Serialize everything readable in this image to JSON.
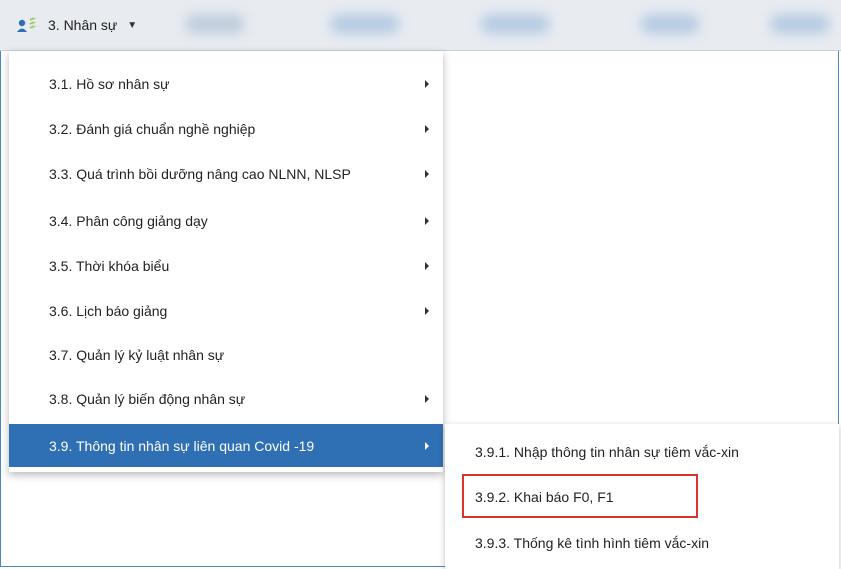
{
  "menubar": {
    "active_menu_label": "3. Nhân sự",
    "icon": "people-icon",
    "caret_icon": "caret-down-icon"
  },
  "dropdown": {
    "items": [
      {
        "label": "3.1. Hồ sơ nhân sự",
        "has_submenu": true
      },
      {
        "label": "3.2. Đánh giá chuẩn nghề nghiệp",
        "has_submenu": true
      },
      {
        "label": "3.3. Quá trình bồi dưỡng nâng cao NLNN, NLSP",
        "has_submenu": true
      },
      {
        "label": "3.4. Phân công giảng dạy",
        "has_submenu": true
      },
      {
        "label": "3.5. Thời khóa biểu",
        "has_submenu": true
      },
      {
        "label": "3.6. Lịch báo giảng",
        "has_submenu": true
      },
      {
        "label": "3.7. Quản lý kỷ luật nhân sự",
        "has_submenu": false
      },
      {
        "label": "3.8. Quản lý biến động nhân sự",
        "has_submenu": true
      },
      {
        "label": "3.9. Thông tin nhân sự liên quan Covid -19",
        "has_submenu": true,
        "active": true
      }
    ]
  },
  "submenu": {
    "items": [
      {
        "label": "3.9.1. Nhập thông tin nhân sự tiêm vắc-xin"
      },
      {
        "label": "3.9.2. Khai báo F0, F1",
        "highlighted": true
      },
      {
        "label": "3.9.3. Thống kê tình hình tiêm vắc-xin"
      }
    ]
  },
  "colors": {
    "active_bg": "#2f6fb3",
    "highlight_border": "#d9342b",
    "menubar_bg": "#e8ecf1"
  }
}
